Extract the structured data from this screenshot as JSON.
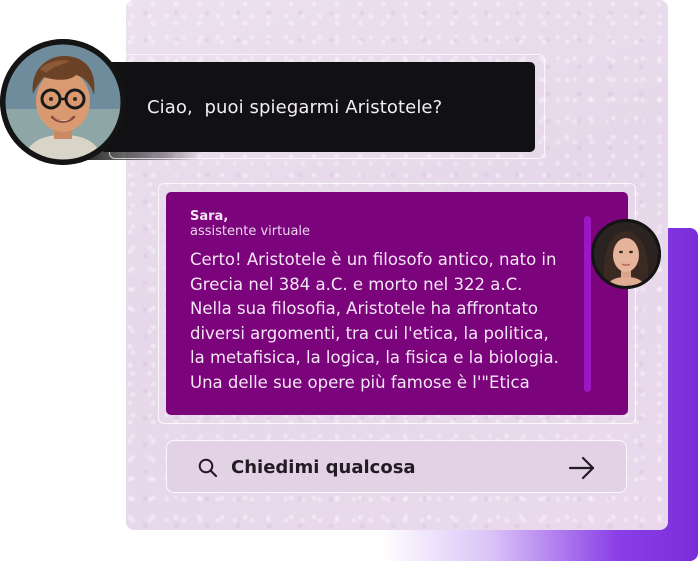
{
  "user": {
    "message": "Ciao,  puoi spiegarmi Aristotele?"
  },
  "assistant": {
    "name": "Sara,",
    "role": "assistente virtuale",
    "message": "Certo! Aristotele è un filosofo antico, nato in Grecia nel 384 a.C. e morto nel 322 a.C. Nella sua filosofia, Aristotele ha affrontato diversi argomenti, tra cui l'etica, la politica, la metafisica, la logica, la fisica e la biologia. Una delle sue opere più famose è l'\"Etica"
  },
  "input": {
    "placeholder": "Chiedimi qualcosa",
    "value": ""
  },
  "icons": {
    "search": "search-icon",
    "send": "arrow-right-icon"
  },
  "colors": {
    "user_bubble": "#111012",
    "assistant_bubble": "#7b037b",
    "accent_purple": "#7a2ed9",
    "card_background": "#e6d8ea"
  }
}
